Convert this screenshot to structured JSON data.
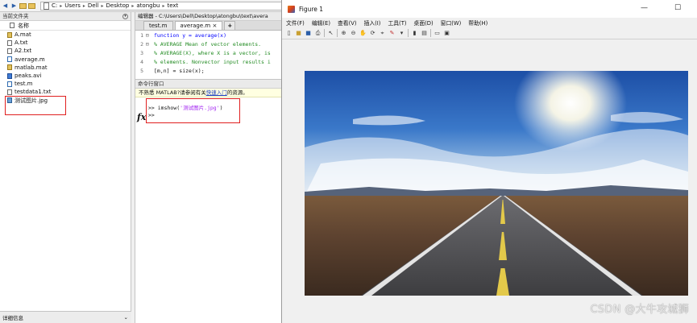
{
  "address_bar": {
    "path": [
      "C:",
      "Users",
      "Dell",
      "Desktop",
      "atongbu",
      "text"
    ]
  },
  "current_folder": {
    "title": "当前文件夹",
    "column_name": "名称",
    "files": [
      {
        "name": "A.mat",
        "type": "mat"
      },
      {
        "name": "A.txt",
        "type": "txt"
      },
      {
        "name": "A2.txt",
        "type": "txt"
      },
      {
        "name": "average.m",
        "type": "m"
      },
      {
        "name": "matlab.mat",
        "type": "mat"
      },
      {
        "name": "peaks.avi",
        "type": "avi"
      },
      {
        "name": "test.m",
        "type": "m"
      },
      {
        "name": "testdata1.txt",
        "type": "txt"
      },
      {
        "name": "测试图片.jpg",
        "type": "img"
      }
    ],
    "details_label": "详细信息"
  },
  "editor": {
    "title": "编辑器 - C:\\Users\\Dell\\Desktop\\atongbu\\text\\avera",
    "tabs": [
      {
        "label": "test.m",
        "active": false
      },
      {
        "label": "average.m",
        "active": true
      }
    ],
    "lines": [
      {
        "num": "1",
        "text": "function y = average(x)"
      },
      {
        "num": "2",
        "text": "% AVERAGE Mean of vector elements."
      },
      {
        "num": "3",
        "text": "% AVERAGE(X), where X is a vector, is"
      },
      {
        "num": "4",
        "text": "% elements. Nonvector input results i"
      },
      {
        "num": "5",
        "text": "[m,n] = size(x);"
      }
    ]
  },
  "command_window": {
    "title": "命令行窗口",
    "notice_prefix": "不熟悉 MATLAB?请参阅有关",
    "notice_link": "快速入门",
    "notice_suffix": "的资源。",
    "command_prompt": ">>",
    "command_text": "imshow(",
    "command_string": "'测试图片.jpg'",
    "command_close": ")",
    "second_prompt": ">>",
    "fx_label": "fx"
  },
  "figure": {
    "title": "Figure 1",
    "menu": [
      "文件(F)",
      "编辑(E)",
      "查看(V)",
      "插入(I)",
      "工具(T)",
      "桌面(D)",
      "窗口(W)",
      "帮助(H)"
    ]
  },
  "watermark": "CSDN @大牛攻城狮"
}
